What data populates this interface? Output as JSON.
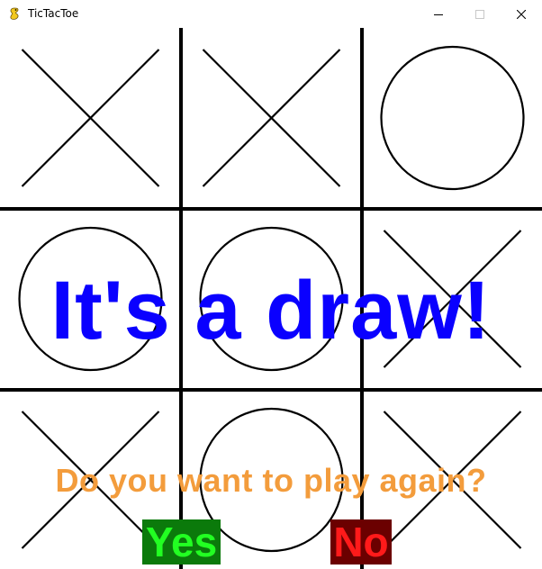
{
  "window": {
    "title": "TicTacToe",
    "controls": [
      "minimize",
      "maximize",
      "close"
    ]
  },
  "board": {
    "cells": [
      [
        "X",
        "X",
        "O"
      ],
      [
        "O",
        "O",
        "X"
      ],
      [
        "X",
        "O",
        "X"
      ]
    ]
  },
  "result": {
    "message": "It's a draw!",
    "color": "#0a00ff"
  },
  "prompt": {
    "question": "Do you want to play again?",
    "color": "#f39c3c",
    "yes": {
      "label": "Yes",
      "bg": "#0b7a0b",
      "text_color": "#22ff22"
    },
    "no": {
      "label": "No",
      "bg": "#6b0000",
      "text_color": "#ff1a1a"
    }
  }
}
